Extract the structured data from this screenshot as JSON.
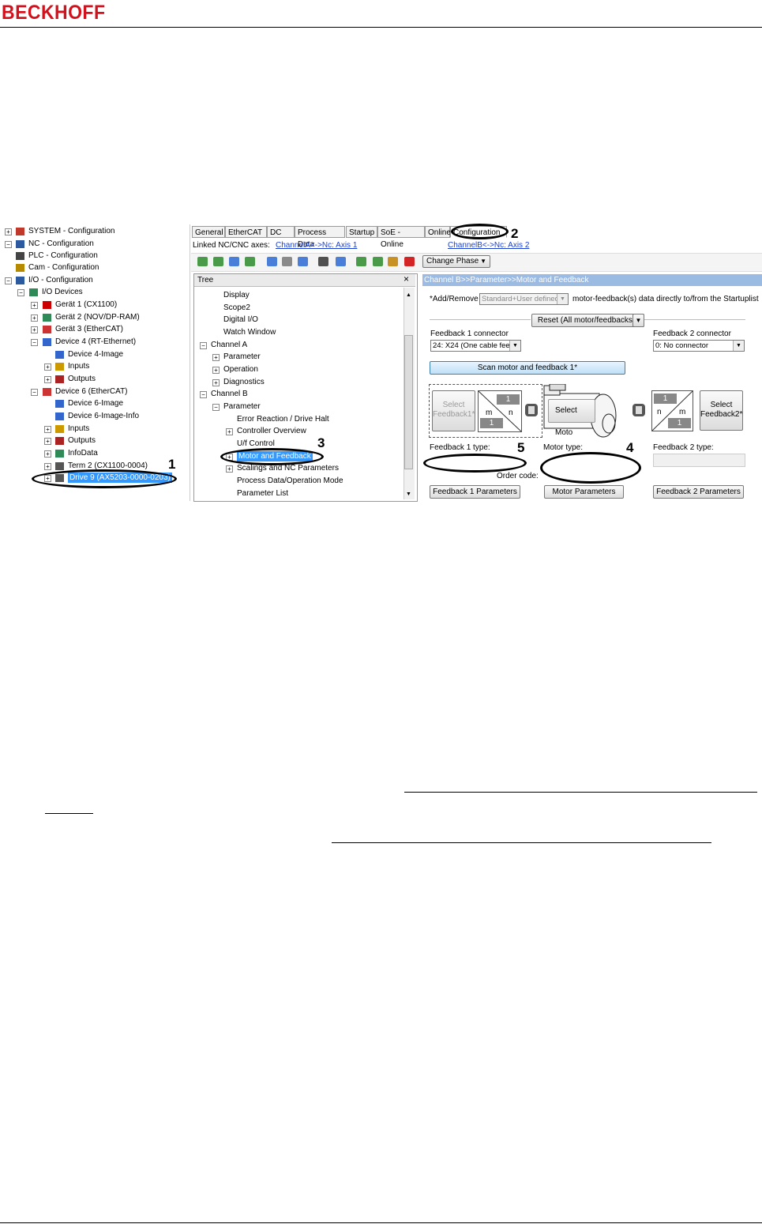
{
  "header": {
    "brand": "BECKHOFF"
  },
  "left_tree": {
    "items": [
      {
        "label": "SYSTEM - Configuration"
      },
      {
        "label": "NC - Configuration"
      },
      {
        "label": "PLC - Configuration"
      },
      {
        "label": "Cam - Configuration"
      },
      {
        "label": "I/O - Configuration"
      },
      {
        "label": "I/O Devices"
      },
      {
        "label": "Gerät 1 (CX1100)"
      },
      {
        "label": "Gerät 2 (NOV/DP-RAM)"
      },
      {
        "label": "Gerät 3 (EtherCAT)"
      },
      {
        "label": "Device 4 (RT-Ethernet)"
      },
      {
        "label": "Device 4-Image"
      },
      {
        "label": "Inputs"
      },
      {
        "label": "Outputs"
      },
      {
        "label": "Device 6 (EtherCAT)"
      },
      {
        "label": "Device 6-Image"
      },
      {
        "label": "Device 6-Image-Info"
      },
      {
        "label": "Inputs"
      },
      {
        "label": "Outputs"
      },
      {
        "label": "InfoData"
      },
      {
        "label": "Term 2 (CX1100-0004)"
      },
      {
        "label": "Drive 9 (AX5203-0000-0203)"
      }
    ]
  },
  "tabs": [
    "General",
    "EtherCAT",
    "DC",
    "Process Data",
    "Startup",
    "SoE - Online",
    "Online",
    "Configuration"
  ],
  "linked": {
    "label": "Linked NC/CNC axes:",
    "channel_a": "ChannelA<->Nc: Axis 1",
    "channel_b": "ChannelB<->Nc: Axis 2"
  },
  "toolbar": {
    "change_phase": "Change Phase"
  },
  "mid_tree": {
    "header": "Tree",
    "close": "×",
    "items": [
      "Display",
      "Scope2",
      "Digital I/O",
      "Watch Window",
      "Channel A",
      "Parameter",
      "Operation",
      "Diagnostics",
      "Channel B",
      "Parameter",
      "Error Reaction / Drive Halt",
      "Controller Overview",
      "U/f Control",
      "Motor and Feedback",
      "Scalings and NC Parameters",
      "Process Data/Operation Mode",
      "Parameter List"
    ]
  },
  "right_panel": {
    "title": "Channel B>>Parameter>>Motor and Feedback",
    "add_remove_label": "*Add/Remove",
    "add_remove_value": "Standard+User defined",
    "add_remove_suffix": "motor-feedback(s) data directly to/from the Startuplist",
    "reset_button": "Reset (All motor/feedbacks)*",
    "fb1_connector_label": "Feedback 1 connector",
    "fb1_connector_value": "24: X24 (One cable fee",
    "fb2_connector_label": "Feedback 2 connector",
    "fb2_connector_value": "0: No connector",
    "scan_button": "Scan motor and feedback 1*",
    "select_fb1": "Select Feedback1*",
    "select_motor": "Select Moto",
    "select_fb2": "Select Feedback2*",
    "gear_left": {
      "n": "n",
      "m": "m",
      "top": "1",
      "bottom": "1"
    },
    "gear_right": {
      "n": "n",
      "m": "m",
      "top": "1",
      "bottom": "1"
    },
    "fb1_type_label": "Feedback 1 type:",
    "motor_type_label": "Motor type:",
    "fb2_type_label": "Feedback 2 type:",
    "order_code_label": "Order code:",
    "fb1_params_button": "Feedback 1 Parameters",
    "motor_params_button": "Motor Parameters",
    "fb2_params_button": "Feedback 2 Parameters"
  },
  "callouts": [
    "1",
    "2",
    "3",
    "4",
    "5"
  ],
  "colors": {
    "brand": "#d3111c",
    "selection": "#3399ff",
    "panel_title": "#9bbbe3",
    "link": "#1a3fd0"
  }
}
